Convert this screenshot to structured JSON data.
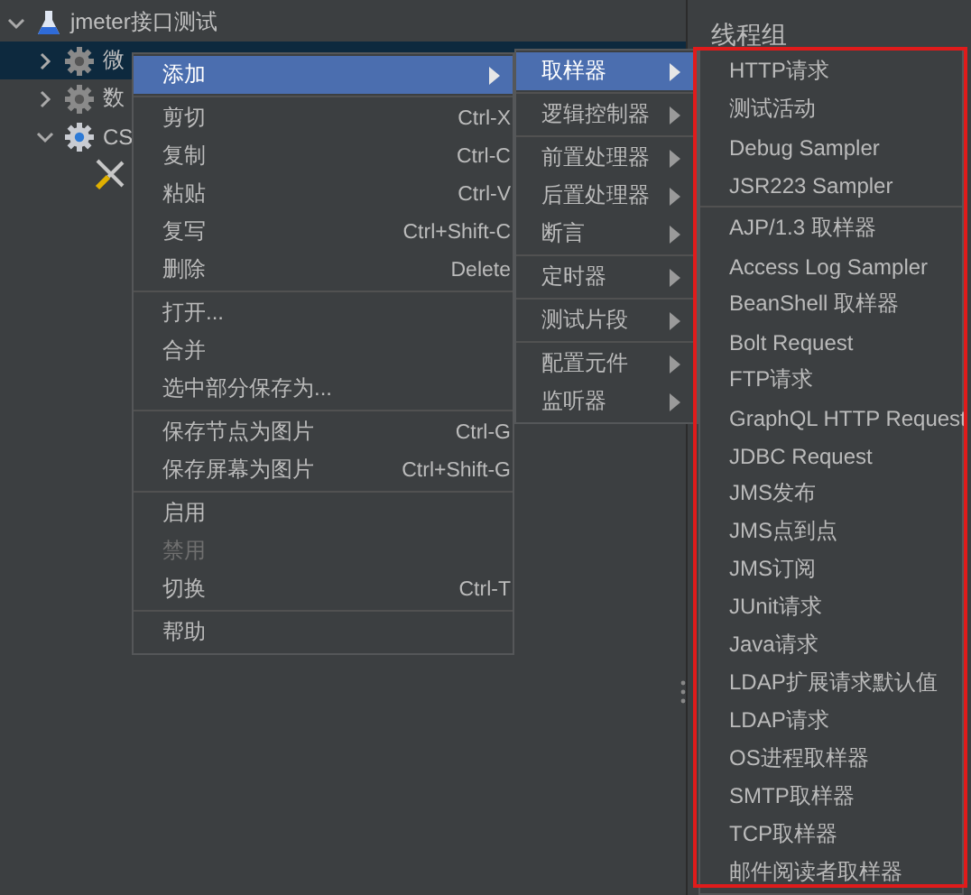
{
  "tree": [
    {
      "label": "jmeter接口测试",
      "kind": "plan",
      "expanded": true,
      "selected": false,
      "children": [
        {
          "label": "微",
          "kind": "group",
          "expanded": false,
          "selected": true
        },
        {
          "label": "数",
          "kind": "group",
          "expanded": false,
          "selected": false
        },
        {
          "label": "CS",
          "kind": "active-group",
          "expanded": true,
          "selected": false,
          "children": [
            {
              "kind": "tool",
              "selected": false
            }
          ]
        }
      ]
    }
  ],
  "panel": {
    "title": "线程组"
  },
  "context_menu": {
    "groups": [
      [
        {
          "label": "添加",
          "submenu": true,
          "selected": true,
          "disabled": false
        }
      ],
      [
        {
          "label": "剪切",
          "shortcut": "Ctrl-X",
          "selected": false,
          "disabled": false
        },
        {
          "label": "复制",
          "shortcut": "Ctrl-C",
          "selected": false,
          "disabled": false
        },
        {
          "label": "粘贴",
          "shortcut": "Ctrl-V",
          "selected": false,
          "disabled": false
        },
        {
          "label": "复写",
          "shortcut": "Ctrl+Shift-C",
          "selected": false,
          "disabled": false
        },
        {
          "label": "删除",
          "shortcut": "Delete",
          "selected": false,
          "disabled": false
        }
      ],
      [
        {
          "label": "打开...",
          "selected": false,
          "disabled": false
        },
        {
          "label": "合并",
          "selected": false,
          "disabled": false
        },
        {
          "label": "选中部分保存为...",
          "selected": false,
          "disabled": false
        }
      ],
      [
        {
          "label": "保存节点为图片",
          "shortcut": "Ctrl-G",
          "selected": false,
          "disabled": false
        },
        {
          "label": "保存屏幕为图片",
          "shortcut": "Ctrl+Shift-G",
          "selected": false,
          "disabled": false
        }
      ],
      [
        {
          "label": "启用",
          "selected": false,
          "disabled": false
        },
        {
          "label": "禁用",
          "selected": false,
          "disabled": true
        },
        {
          "label": "切换",
          "shortcut": "Ctrl-T",
          "selected": false,
          "disabled": false
        }
      ],
      [
        {
          "label": "帮助",
          "selected": false,
          "disabled": false
        }
      ]
    ]
  },
  "add_menu": {
    "groups": [
      [
        {
          "label": "取样器",
          "submenu": true,
          "selected": true,
          "disabled": false
        }
      ],
      [
        {
          "label": "逻辑控制器",
          "submenu": true,
          "selected": false,
          "disabled": false
        }
      ],
      [
        {
          "label": "前置处理器",
          "submenu": true,
          "selected": false,
          "disabled": false
        },
        {
          "label": "后置处理器",
          "submenu": true,
          "selected": false,
          "disabled": false
        },
        {
          "label": "断言",
          "submenu": true,
          "selected": false,
          "disabled": false
        }
      ],
      [
        {
          "label": "定时器",
          "submenu": true,
          "selected": false,
          "disabled": false
        }
      ],
      [
        {
          "label": "测试片段",
          "submenu": true,
          "selected": false,
          "disabled": false
        }
      ],
      [
        {
          "label": "配置元件",
          "submenu": true,
          "selected": false,
          "disabled": false
        },
        {
          "label": "监听器",
          "submenu": true,
          "selected": false,
          "disabled": false
        }
      ]
    ]
  },
  "sampler_menu": {
    "groups": [
      [
        {
          "label": "HTTP请求",
          "selected": false,
          "disabled": false
        },
        {
          "label": "测试活动",
          "selected": false,
          "disabled": false
        },
        {
          "label": "Debug Sampler",
          "selected": false,
          "disabled": false
        },
        {
          "label": "JSR223 Sampler",
          "selected": false,
          "disabled": false
        }
      ],
      [
        {
          "label": "AJP/1.3 取样器",
          "selected": false,
          "disabled": false
        },
        {
          "label": "Access Log Sampler",
          "selected": false,
          "disabled": false
        },
        {
          "label": "BeanShell 取样器",
          "selected": false,
          "disabled": false
        },
        {
          "label": "Bolt Request",
          "selected": false,
          "disabled": false
        },
        {
          "label": "FTP请求",
          "selected": false,
          "disabled": false
        },
        {
          "label": "GraphQL HTTP Request",
          "selected": false,
          "disabled": false
        },
        {
          "label": "JDBC Request",
          "selected": false,
          "disabled": false
        },
        {
          "label": "JMS发布",
          "selected": false,
          "disabled": false
        },
        {
          "label": "JMS点到点",
          "selected": false,
          "disabled": false
        },
        {
          "label": "JMS订阅",
          "selected": false,
          "disabled": false
        },
        {
          "label": "JUnit请求",
          "selected": false,
          "disabled": false
        },
        {
          "label": "Java请求",
          "selected": false,
          "disabled": false
        },
        {
          "label": "LDAP扩展请求默认值",
          "selected": false,
          "disabled": false
        },
        {
          "label": "LDAP请求",
          "selected": false,
          "disabled": false
        },
        {
          "label": "OS进程取样器",
          "selected": false,
          "disabled": false
        },
        {
          "label": "SMTP取样器",
          "selected": false,
          "disabled": false
        },
        {
          "label": "TCP取样器",
          "selected": false,
          "disabled": false
        },
        {
          "label": "邮件阅读者取样器",
          "selected": false,
          "disabled": false
        }
      ]
    ]
  }
}
